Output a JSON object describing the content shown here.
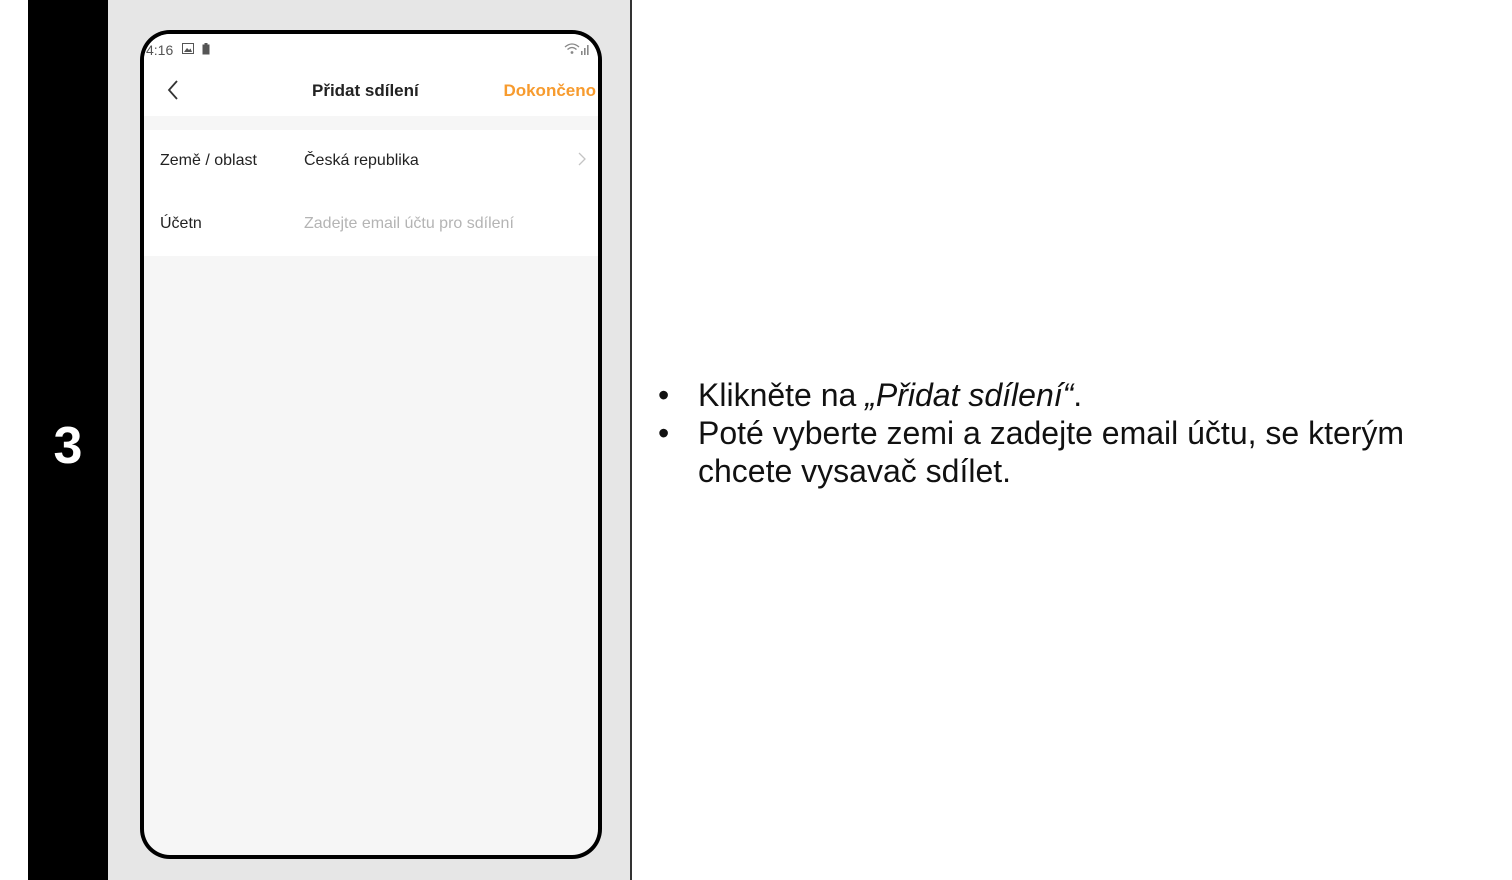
{
  "step": {
    "number": "3"
  },
  "phone": {
    "status_bar": {
      "time": "4:16",
      "icons": [
        "image-icon",
        "battery-icon"
      ],
      "signal_icons": [
        "wifi-icon",
        "cellular-signal-icon"
      ]
    },
    "nav": {
      "back_icon": "chevron-left-icon",
      "title": "Přidat sdílení",
      "done_label": "Dokončeno"
    },
    "form": {
      "rows": [
        {
          "label": "Země / oblast",
          "value": "Česká republika",
          "icon": "chevron-right-icon"
        },
        {
          "label": "Účetn",
          "value": "",
          "placeholder": "Zadejte email účtu pro sdílení"
        }
      ]
    }
  },
  "instructions": {
    "bullet1_prefix": "Klikněte na ",
    "bullet1_quote": "„Přidat sdílení“",
    "bullet1_suffix": ".",
    "bullet2": "Poté vyberte zemi a zadejte email účtu, se kterým chcete vysavač sdílet."
  },
  "colors": {
    "accent": "#f79b2e",
    "step_bg": "#000000",
    "panel_bg": "#e6e6e6"
  }
}
